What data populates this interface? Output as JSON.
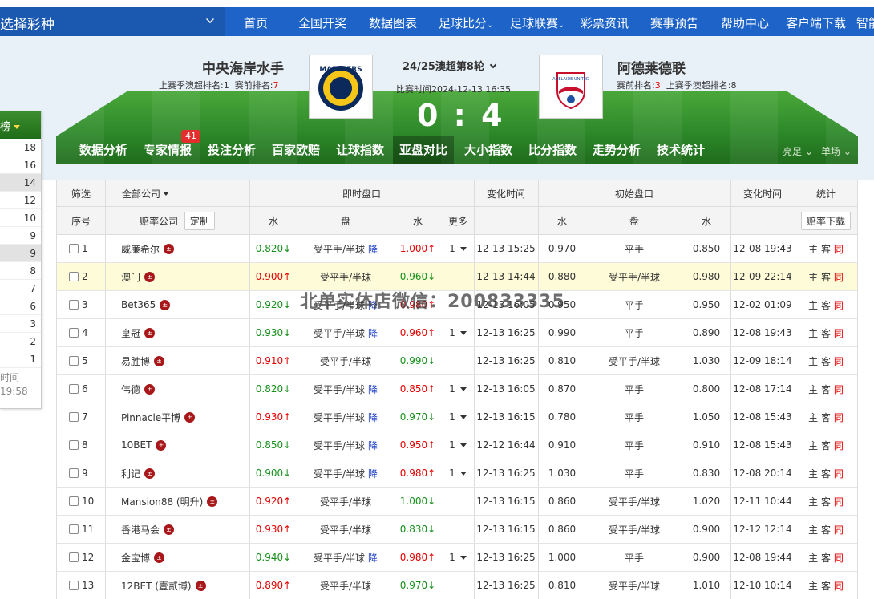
{
  "topnav": {
    "lottery": "选择彩种",
    "items": [
      "首页",
      "全国开奖",
      "数据图表",
      "足球比分",
      "足球联赛",
      "彩票资讯",
      "赛事预告",
      "帮助中心",
      "客户端下载",
      "智能"
    ]
  },
  "match": {
    "home": {
      "name": "中央海岸水手",
      "prev_label": "上赛季澳超排名:",
      "prev_rank": "1",
      "cur_label": "赛前排名:",
      "cur_rank": "7",
      "logo_text": "MARINERS"
    },
    "away": {
      "name": "阿德莱德联",
      "cur_label": "赛前排名:",
      "cur_rank": "3",
      "prev_label": "上赛季澳超排名:",
      "prev_rank": "8",
      "logo_text": "ADELAIDE UNITED"
    },
    "round": "24/25澳超第8轮",
    "time": "比赛时间2024-12-13 16:35",
    "score": "0 : 4"
  },
  "tabs": [
    "数据分析",
    "专家情报",
    "投注分析",
    "百家欧赔",
    "让球指数",
    "亚盘对比",
    "大小指数",
    "比分指数",
    "走势分析",
    "技术统计"
  ],
  "tab_badge": "41",
  "tab_right": [
    "亮足",
    "单场"
  ],
  "left_panel": {
    "title": "榜",
    "values": [
      "18",
      "16",
      "14",
      "12",
      "10",
      "9",
      "9",
      "8",
      "7",
      "6",
      "3",
      "2",
      "1"
    ],
    "foot1": "时间",
    "foot2": "19:58"
  },
  "table": {
    "head1": {
      "filter": "筛选",
      "company": "全部公司",
      "live": "即时盘口",
      "change1": "变化时间",
      "initial": "初始盘口",
      "change2": "变化时间",
      "stats": "统计"
    },
    "head2": {
      "no": "序号",
      "company": "赔率公司",
      "custom": "定制",
      "w1": "水",
      "pan": "盘",
      "w2": "水",
      "more": "更多",
      "iw1": "水",
      "ipan": "盘",
      "iw2": "水",
      "download": "赔率下载"
    },
    "rows": [
      {
        "no": "1",
        "name": "威廉希尔",
        "w1": "0.820↓",
        "pan": "受平手/半球",
        "fall": "降",
        "w2": "1.000↑",
        "more": "1",
        "t1": "12-13 15:25",
        "iw1": "0.970",
        "ipan": "平手",
        "iw2": "0.850",
        "t2": "12-08 19:43",
        "st": [
          "主",
          "客",
          "同"
        ]
      },
      {
        "no": "2",
        "name": "澳门",
        "w1": "0.900↑",
        "pan": "受平手/半球",
        "fall": "",
        "w2": "0.960↓",
        "more": "",
        "t1": "12-13 14:44",
        "iw1": "0.880",
        "ipan": "受平手/半球",
        "iw2": "0.980",
        "t2": "12-09 22:14",
        "st": [
          "主",
          "客",
          "同"
        ]
      },
      {
        "no": "3",
        "name": "Bet365",
        "w1": "0.920↓",
        "pan": "受平手/半球",
        "fall": "降",
        "w2": "0.980↑",
        "more": "",
        "t1": "12-13 16:05",
        "iw1": "0.950",
        "ipan": "平手",
        "iw2": "0.950",
        "t2": "12-02 01:09",
        "st": [
          "主",
          "客",
          "同"
        ]
      },
      {
        "no": "4",
        "name": "皇冠",
        "w1": "0.930↓",
        "pan": "受平手/半球",
        "fall": "降",
        "w2": "0.960↑",
        "more": "1",
        "t1": "12-13 16:25",
        "iw1": "0.990",
        "ipan": "平手",
        "iw2": "0.890",
        "t2": "12-08 19:43",
        "st": [
          "主",
          "客",
          "同"
        ]
      },
      {
        "no": "5",
        "name": "易胜博",
        "w1": "0.910↑",
        "pan": "受平手/半球",
        "fall": "",
        "w2": "0.990↓",
        "more": "",
        "t1": "12-13 16:25",
        "iw1": "0.810",
        "ipan": "受平手/半球",
        "iw2": "1.030",
        "t2": "12-09 18:14",
        "st": [
          "主",
          "客",
          "同"
        ]
      },
      {
        "no": "6",
        "name": "伟德",
        "w1": "0.820↓",
        "pan": "受平手/半球",
        "fall": "降",
        "w2": "0.850↑",
        "more": "1",
        "t1": "12-13 16:05",
        "iw1": "0.870",
        "ipan": "平手",
        "iw2": "0.800",
        "t2": "12-08 17:14",
        "st": [
          "主",
          "客",
          "同"
        ]
      },
      {
        "no": "7",
        "name": "Pinnacle平博",
        "w1": "0.930↑",
        "pan": "受平手/半球",
        "fall": "降",
        "w2": "0.970↓",
        "more": "1",
        "t1": "12-13 16:15",
        "iw1": "0.780",
        "ipan": "平手",
        "iw2": "1.050",
        "t2": "12-08 15:43",
        "st": [
          "主",
          "客",
          "同"
        ]
      },
      {
        "no": "8",
        "name": "10BET",
        "w1": "0.850↓",
        "pan": "受平手/半球",
        "fall": "降",
        "w2": "0.950↑",
        "more": "1",
        "t1": "12-12 16:44",
        "iw1": "0.910",
        "ipan": "平手",
        "iw2": "0.910",
        "t2": "12-08 15:43",
        "st": [
          "主",
          "客",
          "同"
        ]
      },
      {
        "no": "9",
        "name": "利记",
        "w1": "0.900↓",
        "pan": "受平手/半球",
        "fall": "降",
        "w2": "0.980↑",
        "more": "1",
        "t1": "12-13 16:25",
        "iw1": "1.030",
        "ipan": "平手",
        "iw2": "0.830",
        "t2": "12-08 20:14",
        "st": [
          "主",
          "客",
          "同"
        ]
      },
      {
        "no": "10",
        "name": "Mansion88 (明升)",
        "w1": "0.920↑",
        "pan": "受平手/半球",
        "fall": "",
        "w2": "1.000↓",
        "more": "",
        "t1": "12-13 16:15",
        "iw1": "0.860",
        "ipan": "受平手/半球",
        "iw2": "1.020",
        "t2": "12-11 10:44",
        "st": [
          "主",
          "客",
          "同"
        ]
      },
      {
        "no": "11",
        "name": "香港马会",
        "w1": "0.930↑",
        "pan": "受平手/半球",
        "fall": "",
        "w2": "0.830↓",
        "more": "",
        "t1": "12-13 16:15",
        "iw1": "0.860",
        "ipan": "受平手/半球",
        "iw2": "0.900",
        "t2": "12-12 12:14",
        "st": [
          "主",
          "客",
          "同"
        ]
      },
      {
        "no": "12",
        "name": "金宝博",
        "w1": "0.940↓",
        "pan": "受平手/半球",
        "fall": "降",
        "w2": "0.980↑",
        "more": "1",
        "t1": "12-13 16:25",
        "iw1": "1.000",
        "ipan": "平手",
        "iw2": "0.900",
        "t2": "12-08 19:44",
        "st": [
          "主",
          "客",
          "同"
        ]
      },
      {
        "no": "13",
        "name": "12BET (壹贰博)",
        "w1": "0.890↑",
        "pan": "受平手/半球",
        "fall": "",
        "w2": "0.970↓",
        "more": "",
        "t1": "12-13 16:25",
        "iw1": "0.810",
        "ipan": "受平手/半球",
        "iw2": "1.010",
        "t2": "12-10 10:14",
        "st": [
          "主",
          "客",
          "同"
        ]
      }
    ]
  },
  "watermark": "北单实体店微信：200833335",
  "colors": {
    "nav": "#1e64c8",
    "up": "#e60000",
    "down": "#16901a",
    "highlight": "#fdfbd8",
    "field": "#2e8a2a"
  }
}
